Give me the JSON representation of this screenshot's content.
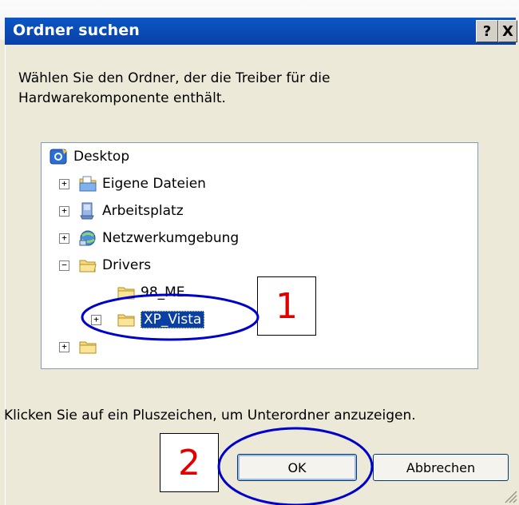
{
  "window": {
    "title": "Ordner suchen",
    "help_button": "?",
    "close_button": "X"
  },
  "instruction": "Wählen Sie den Ordner, der die Treiber für die Hardwarekomponente enthält.",
  "tree": {
    "items": [
      {
        "label": "Desktop",
        "icon": "desktop-icon",
        "expander": ""
      },
      {
        "label": "Eigene Dateien",
        "icon": "documents-folder-icon",
        "expander": "+"
      },
      {
        "label": "Arbeitsplatz",
        "icon": "my-computer-icon",
        "expander": "+"
      },
      {
        "label": "Netzwerkumgebung",
        "icon": "network-places-icon",
        "expander": "+"
      },
      {
        "label": "Drivers",
        "icon": "folder-open-icon",
        "expander": "−"
      },
      {
        "label": "98_ME",
        "icon": "folder-icon",
        "expander": ""
      },
      {
        "label": "XP_Vista",
        "icon": "folder-icon",
        "expander": "+",
        "selected": true
      },
      {
        "label": "",
        "icon": "folder-icon",
        "expander": "+"
      }
    ]
  },
  "hint": "Klicken Sie auf ein Pluszeichen, um Unterordner anzuzeigen.",
  "buttons": {
    "ok": "OK",
    "cancel": "Abbrechen"
  },
  "annotations": {
    "step1": "1",
    "step2": "2",
    "color": "#e00000",
    "ellipse_color": "#0000cc"
  }
}
